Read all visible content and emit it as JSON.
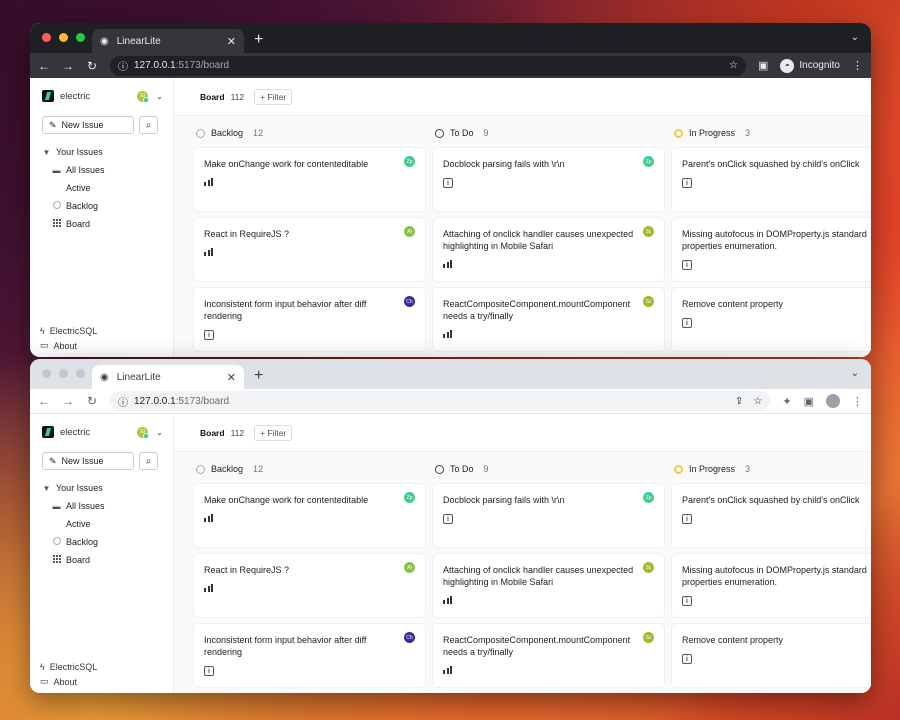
{
  "windows": [
    {
      "theme": "dark",
      "tab_title": "LinearLite",
      "url_host": "127.0.0.1",
      "url_path": ":5173/board",
      "profile_label": "Incognito"
    },
    {
      "theme": "light",
      "tab_title": "LinearLite",
      "url_host": "127.0.0.1",
      "url_path": ":5173/board",
      "profile_label": ""
    }
  ],
  "sidebar": {
    "brand": "electric",
    "user_initials": "El",
    "new_issue": "New Issue",
    "your_issues": "Your Issues",
    "items": [
      {
        "label": "All Issues"
      },
      {
        "label": "Active"
      },
      {
        "label": "Backlog"
      },
      {
        "label": "Board"
      }
    ],
    "footer": [
      {
        "label": "ElectricSQL"
      },
      {
        "label": "About"
      }
    ]
  },
  "topbar": {
    "label": "Board",
    "count": "112",
    "filter": "+ Filter"
  },
  "columns": [
    {
      "name": "Backlog",
      "count": "12",
      "cards": [
        {
          "title": "Make onChange work for contenteditable",
          "avatar": "Zp",
          "avatar_color": "#3ecf8e",
          "priority": "bars"
        },
        {
          "title": "React in RequireJS ?",
          "avatar": "Al",
          "avatar_color": "#8bc34a",
          "priority": "bars"
        },
        {
          "title": "Inconsistent form input behavior after diff rendering",
          "avatar": "Ch",
          "avatar_color": "#3a2b9c",
          "priority": "info"
        }
      ]
    },
    {
      "name": "To Do",
      "count": "9",
      "cards": [
        {
          "title": "Docblock parsing fails with \\r\\n",
          "avatar": "Zp",
          "avatar_color": "#3ecf8e",
          "priority": "info"
        },
        {
          "title": "Attaching of onclick handler causes unexpected highlighting in Mobile Safari",
          "avatar": "Sc",
          "avatar_color": "#a6b82e",
          "priority": "bars"
        },
        {
          "title": "ReactCompositeComponent.mountComponent needs a try/finally",
          "avatar": "Sc",
          "avatar_color": "#a6b82e",
          "priority": "bars"
        }
      ]
    },
    {
      "name": "In Progress",
      "count": "3",
      "cards": [
        {
          "title": "Parent's onClick squashed by child's onClick",
          "avatar": "",
          "avatar_color": "",
          "priority": "info"
        },
        {
          "title": "Missing autofocus in DOMProperty.js standard properties enumeration.",
          "avatar": "",
          "avatar_color": "",
          "priority": "info"
        },
        {
          "title": "Remove content property",
          "avatar": "",
          "avatar_color": "",
          "priority": "info"
        }
      ]
    }
  ]
}
